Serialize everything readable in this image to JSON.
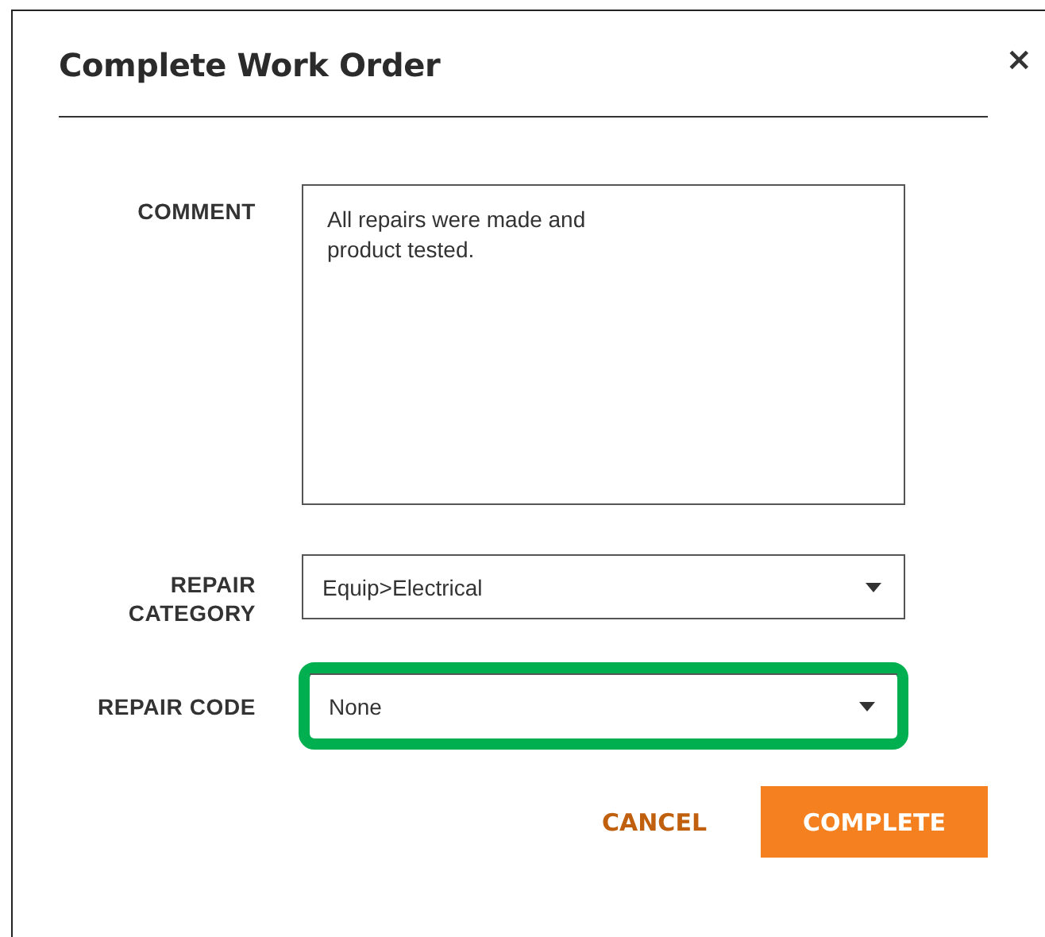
{
  "dialog": {
    "title": "Complete Work Order",
    "close": "×"
  },
  "fields": [
    {
      "kind": "textarea",
      "label": "COMMENT",
      "value": "All repairs were made and\nproduct tested.",
      "highlighted": false
    },
    {
      "kind": "select",
      "label": "REPAIR CATEGORY",
      "value": "Equip>Electrical",
      "highlighted": false
    },
    {
      "kind": "select",
      "label": "REPAIR CODE",
      "value": "None",
      "highlighted": true
    }
  ],
  "buttons": [
    {
      "label": "CANCEL",
      "kind": "link"
    },
    {
      "label": "COMPLETE",
      "kind": "primary"
    }
  ]
}
